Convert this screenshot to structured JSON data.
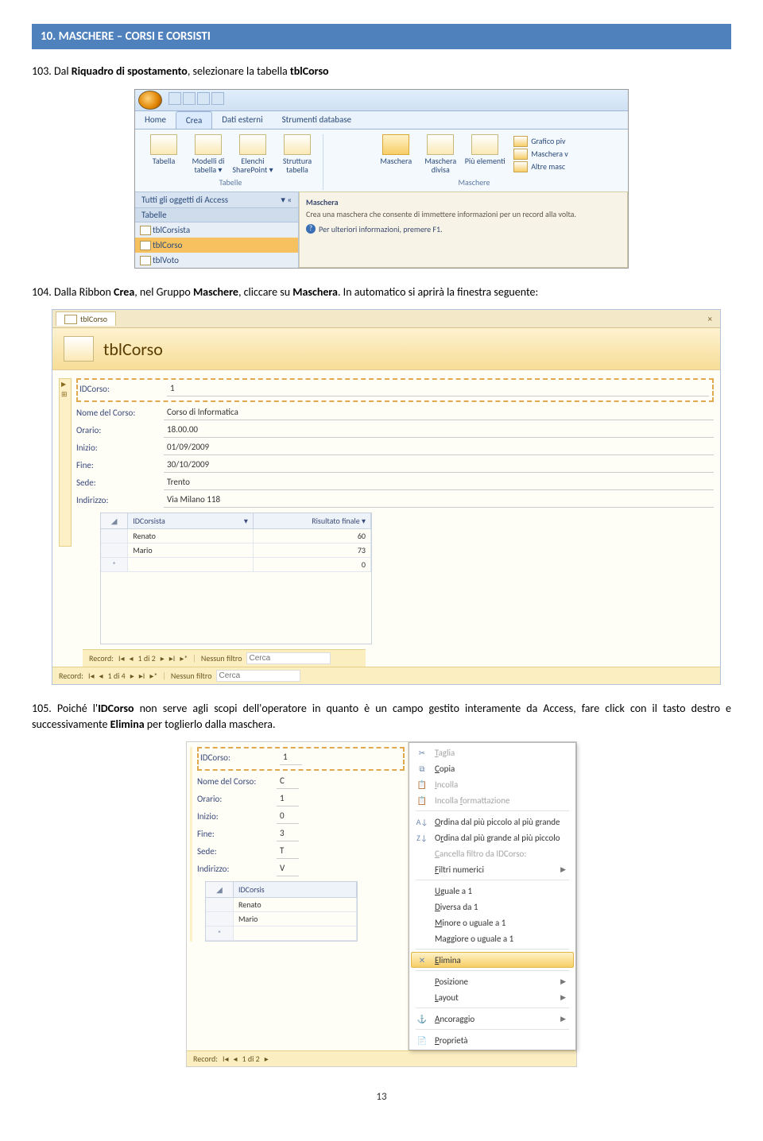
{
  "section": {
    "title": "10. MASCHERE – CORSI E CORSISTI"
  },
  "p103": {
    "num": "103.",
    "text1": "Dal ",
    "bold1": "Riquadro di spostamento",
    "text2": ", selezionare la tabella ",
    "bold2": "tblCorso"
  },
  "p104": {
    "num": "104.",
    "text1": "Dalla Ribbon ",
    "bold1": "Crea",
    "text2": ", nel Gruppo ",
    "bold2": "Maschere",
    "text3": ", cliccare su ",
    "bold3": "Maschera",
    "text4": ". In automatico si aprirà la finestra seguente:"
  },
  "p105": {
    "num": "105.",
    "text1": "Poiché l'",
    "bold1": "IDCorso",
    "text2": " non serve agli scopi dell'operatore in quanto è un campo gestito interamente da Access, fare click con il tasto destro e successivamente ",
    "bold2": "Elimina",
    "text3": " per toglierlo dalla maschera."
  },
  "ribbon": {
    "tabs": [
      "Home",
      "Crea",
      "Dati esterni",
      "Strumenti database"
    ],
    "group_tabelle": {
      "items": [
        {
          "label": "Tabella"
        },
        {
          "label": "Modelli di tabella ▾"
        },
        {
          "label": "Elenchi SharePoint ▾"
        },
        {
          "label": "Struttura tabella"
        }
      ],
      "label": "Tabelle"
    },
    "group_maschere": {
      "items": [
        {
          "label": "Maschera"
        },
        {
          "label": "Maschera divisa"
        },
        {
          "label": "Più elementi"
        }
      ],
      "side": [
        "Grafico piv",
        "Maschera v",
        "Altre masc"
      ],
      "label": "Maschere"
    },
    "nav": {
      "header": "Tutti gli oggetti di Access",
      "cat": "Tabelle",
      "items": [
        "tblCorsista",
        "tblCorso",
        "tblVoto"
      ]
    },
    "tooltip": {
      "title": "Maschera",
      "desc": "Crea una maschera che consente di immettere informazioni per un record alla volta.",
      "help": "Per ulteriori informazioni, premere F1."
    }
  },
  "form": {
    "tab": "tblCorso",
    "title": "tblCorso",
    "fields": [
      {
        "label": "IDCorso:",
        "value": "1"
      },
      {
        "label": "Nome del Corso:",
        "value": "Corso di Informatica"
      },
      {
        "label": "Orario:",
        "value": "18.00.00"
      },
      {
        "label": "Inizio:",
        "value": "01/09/2009"
      },
      {
        "label": "Fine:",
        "value": "30/10/2009"
      },
      {
        "label": "Sede:",
        "value": "Trento"
      },
      {
        "label": "Indirizzo:",
        "value": "Via Milano 118"
      }
    ],
    "subgrid": {
      "headers": [
        "IDCorsista",
        "Risultato finale"
      ],
      "rows": [
        {
          "name": "Renato",
          "score": "60"
        },
        {
          "name": "Mario",
          "score": "73"
        },
        {
          "name": "",
          "score": "0"
        }
      ]
    },
    "recnav_inner": {
      "label": "Record:",
      "pos": "1 di 2",
      "filter": "Nessun filtro",
      "search": "Cerca"
    },
    "recnav_outer": {
      "label": "Record:",
      "pos": "1 di 4",
      "filter": "Nessun filtro",
      "search": "Cerca"
    }
  },
  "ctx_form": {
    "fields": [
      {
        "label": "IDCorso:",
        "value": "1"
      },
      {
        "label": "Nome del Corso:",
        "value": "C"
      },
      {
        "label": "Orario:",
        "value": "1"
      },
      {
        "label": "Inizio:",
        "value": "0"
      },
      {
        "label": "Fine:",
        "value": "3"
      },
      {
        "label": "Sede:",
        "value": "T"
      },
      {
        "label": "Indirizzo:",
        "value": "V"
      }
    ],
    "subhead": "IDCorsis",
    "subrows": [
      "Renato",
      "Mario"
    ],
    "recnav": {
      "label": "Record:",
      "pos": "1 di 2"
    }
  },
  "context_menu": [
    {
      "icon": "✂",
      "label": "Taglia",
      "u": "T",
      "disabled": true
    },
    {
      "icon": "⧉",
      "label": "Copia",
      "u": "C"
    },
    {
      "icon": "📋",
      "label": "Incolla",
      "u": "I",
      "disabled": true
    },
    {
      "icon": "📋",
      "label": "Incolla formattazione",
      "u": "f",
      "disabled": true
    },
    {
      "sep": true
    },
    {
      "icon": "A↓",
      "label": "Ordina dal più piccolo al più grande",
      "u": "O"
    },
    {
      "icon": "Z↓",
      "label": "Ordina dal più grande al più piccolo",
      "u": "r"
    },
    {
      "icon": "",
      "label": "Cancella filtro da IDCorso:",
      "u": "C",
      "disabled": true
    },
    {
      "icon": "",
      "label": "Filtri numerici",
      "u": "F",
      "arrow": true
    },
    {
      "sep": true
    },
    {
      "icon": "",
      "label": "Uguale a 1",
      "u": "U"
    },
    {
      "icon": "",
      "label": "Diversa da 1",
      "u": "D"
    },
    {
      "icon": "",
      "label": "Minore o uguale a 1",
      "u": "M"
    },
    {
      "icon": "",
      "label": "Maggiore o uguale a 1",
      "u": "g"
    },
    {
      "sep": true
    },
    {
      "icon": "✕",
      "label": "Elimina",
      "u": "E",
      "highlight": true
    },
    {
      "sep": true
    },
    {
      "icon": "",
      "label": "Posizione",
      "u": "P",
      "arrow": true
    },
    {
      "icon": "",
      "label": "Layout",
      "u": "L",
      "arrow": true
    },
    {
      "sep": true
    },
    {
      "icon": "⚓",
      "label": "Ancoraggio",
      "u": "A",
      "arrow": true
    },
    {
      "sep": true
    },
    {
      "icon": "📄",
      "label": "Proprietà",
      "u": "P"
    }
  ],
  "page_number": "13"
}
